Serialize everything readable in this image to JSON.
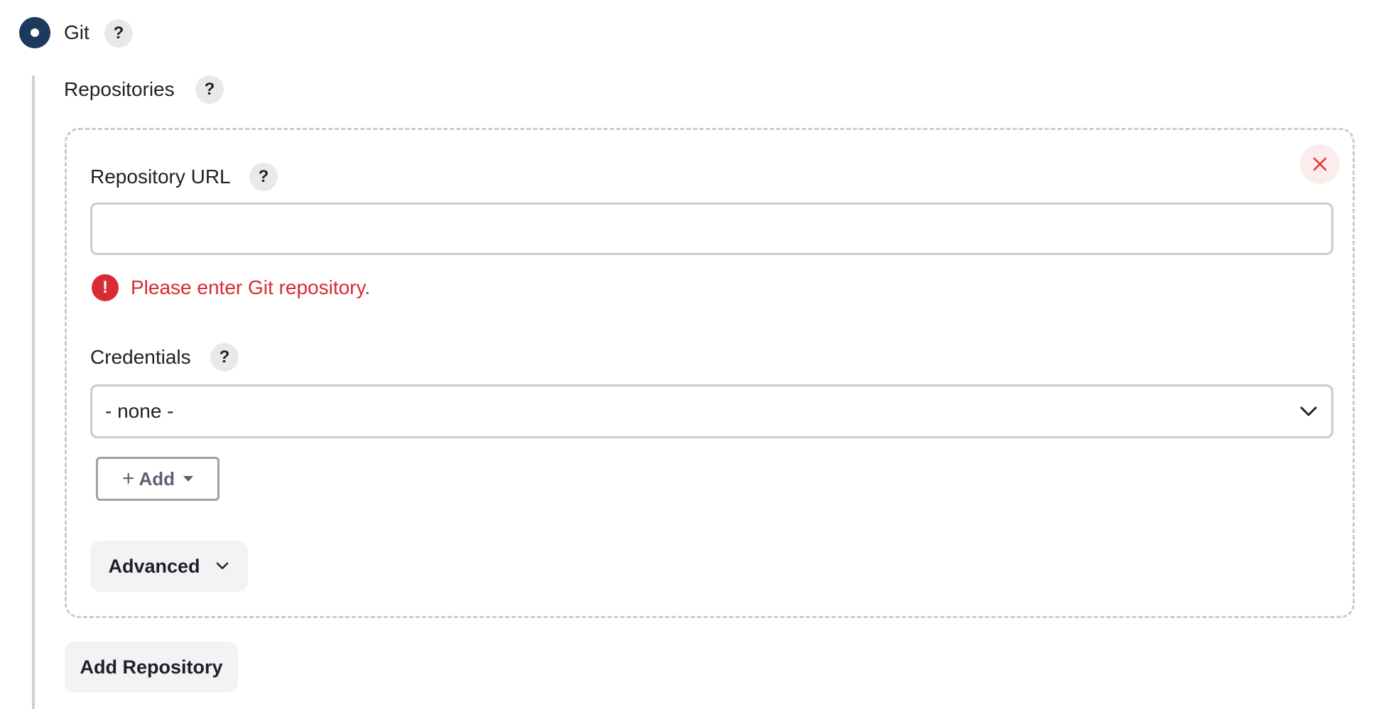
{
  "scm_option": {
    "label": "Git",
    "selected": true,
    "help": "?"
  },
  "repositories": {
    "label": "Repositories",
    "help": "?",
    "repository_url": {
      "label": "Repository URL",
      "help": "?",
      "value": "",
      "error": {
        "icon": "!",
        "message": "Please enter Git repository."
      }
    },
    "credentials": {
      "label": "Credentials",
      "help": "?",
      "selected": "- none -",
      "add_plus": "+",
      "add_label": "Add"
    },
    "advanced_label": "Advanced",
    "add_repository_label": "Add Repository"
  },
  "colors": {
    "radio": "#1b3a5c",
    "error": "#d92b32",
    "close": "#e0353b"
  },
  "icons": [
    "radio-selected-icon",
    "help-icon",
    "close-icon",
    "error-icon",
    "chevron-down-icon",
    "plus-icon",
    "caret-down-icon"
  ]
}
